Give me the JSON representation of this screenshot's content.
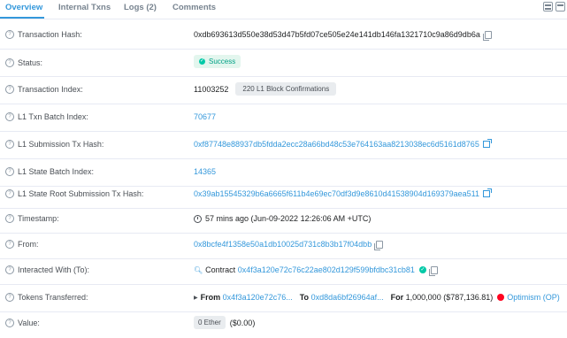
{
  "tabs": [
    {
      "label": "Overview",
      "active": true
    },
    {
      "label": "Internal Txns",
      "active": false
    },
    {
      "label": "Logs (2)",
      "active": false
    },
    {
      "label": "Comments",
      "active": false
    }
  ],
  "rows": {
    "tx_hash": {
      "label": "Transaction Hash:",
      "value": "0xdb693613d550e38d53d47b5fd07ce505e24e141db146fa1321710c9a86d9db6a"
    },
    "status": {
      "label": "Status:",
      "value": "Success"
    },
    "tx_index": {
      "label": "Transaction Index:",
      "value": "11003252",
      "badge": "220 L1 Block Confirmations"
    },
    "batch_index": {
      "label": "L1 Txn Batch Index:",
      "value": "70677"
    },
    "submission_hash": {
      "label": "L1 Submission Tx Hash:",
      "value": "0xf87748e88937db5fdda2ecc28a66bd48c53e764163aa8213038ec6d5161d8765"
    },
    "state_batch": {
      "label": "L1 State Batch Index:",
      "value": "14365"
    },
    "state_root": {
      "label": "L1 State Root Submission Tx Hash:",
      "value": "0x39ab15545329b6a6665f611b4e69ec70df3d9e8610d41538904d169379aea511"
    },
    "timestamp": {
      "label": "Timestamp:",
      "value": "57 mins ago (Jun-09-2022 12:26:06 AM +UTC)"
    },
    "from": {
      "label": "From:",
      "value": "0x8bcfe4f1358e50a1db10025d731c8b3b17f04dbb"
    },
    "interacted": {
      "label": "Interacted With (To):",
      "prefix": "Contract",
      "value": "0x4f3a120e72c76c22ae802d129f599bfdbc31cb81"
    },
    "tokens": {
      "label": "Tokens Transferred:",
      "from_label": "From",
      "from_value": "0x4f3a120e72c76...",
      "to_label": "To",
      "to_value": "0xd8da6bf26964af...",
      "for_label": "For",
      "amount": "1,000,000 ($787,136.81)",
      "token": "Optimism (OP)"
    },
    "value": {
      "label": "Value:",
      "ether": "0 Ether",
      "usd": "($0.00)"
    }
  },
  "colors": {
    "link": "#3498db",
    "success": "#00a186",
    "op": "#ff0420"
  }
}
